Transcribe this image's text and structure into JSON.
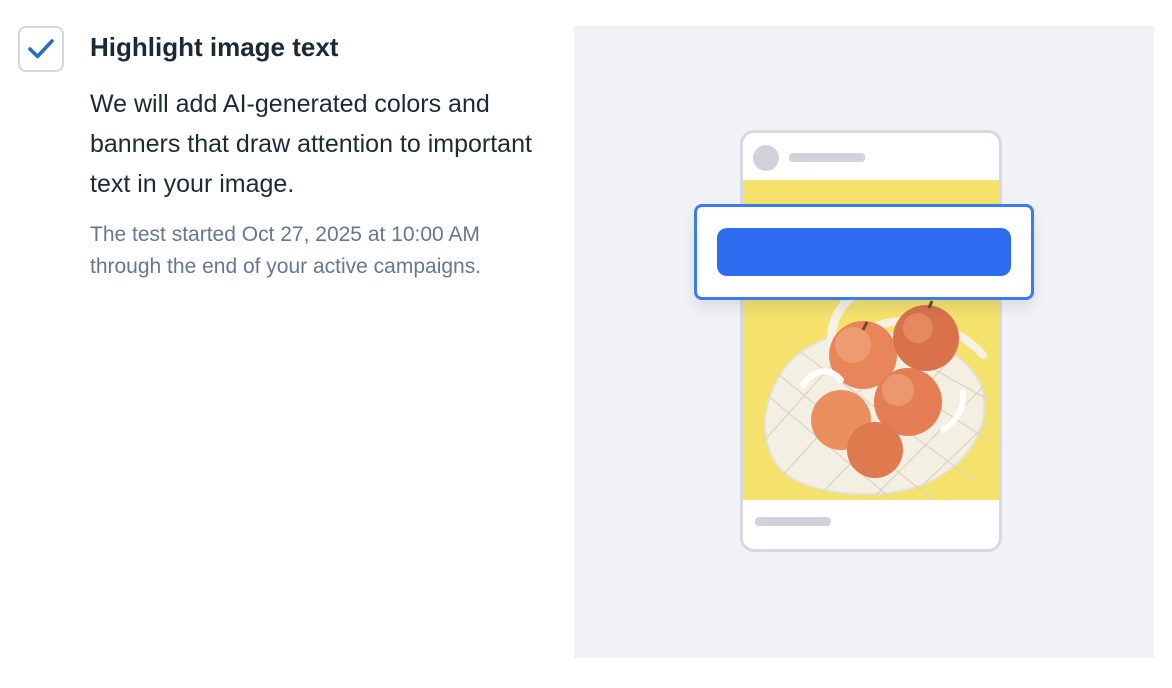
{
  "option": {
    "checked": true,
    "check_icon": "checkmark-icon",
    "title": "Highlight image text",
    "description": "We will add AI-generated colors and banners that draw attention to important text in your image.",
    "note": "The test started Oct 27, 2025 at 10:00 AM through the end of your active campaigns."
  },
  "preview": {
    "image_description_icon": "peaches-in-mesh-bag-image",
    "colors": {
      "panel_background": "#f1f2f6",
      "image_background": "#f4e26c",
      "banner_border": "#3b7bf0",
      "banner_fill": "#2d6cf0",
      "checkmark": "#2d6cb5"
    }
  }
}
